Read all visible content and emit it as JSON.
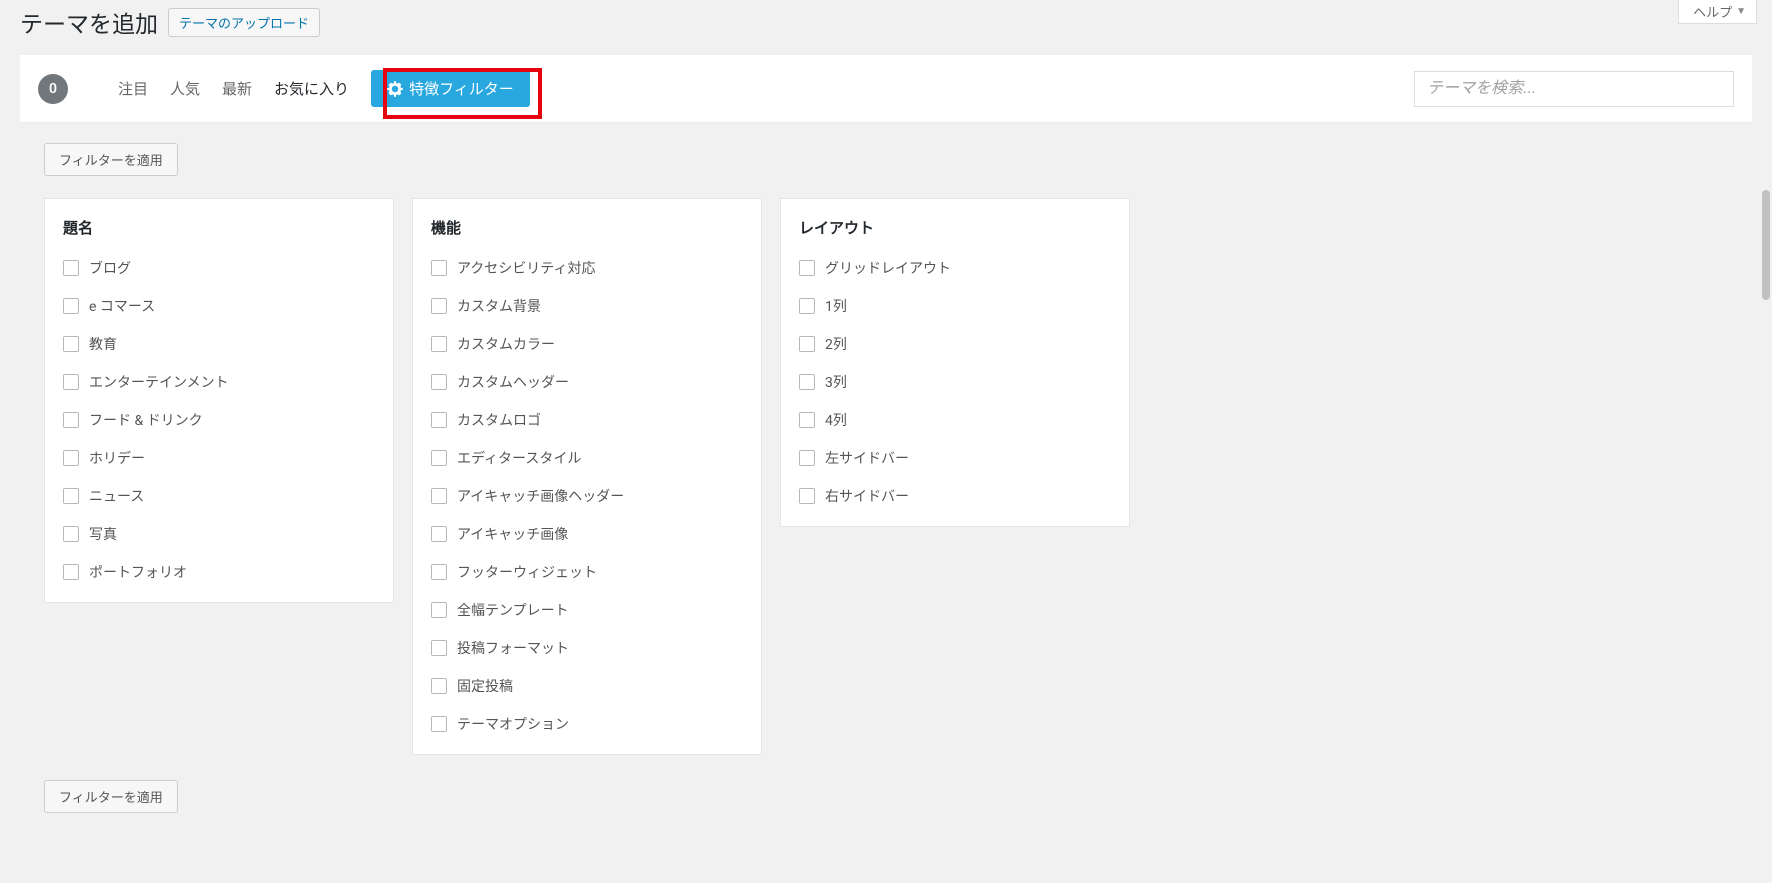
{
  "header": {
    "title": "テーマを追加",
    "upload_button": "テーマのアップロード",
    "help_label": "ヘルプ"
  },
  "toolbar": {
    "count": "0",
    "tabs": {
      "featured": "注目",
      "popular": "人気",
      "latest": "最新",
      "favorites": "お気に入り"
    },
    "feature_filter": "特徴フィルター",
    "search_placeholder": "テーマを検索..."
  },
  "apply_filter": "フィルターを適用",
  "filters": {
    "subject": {
      "heading": "題名",
      "items": [
        "ブログ",
        "e コマース",
        "教育",
        "エンターテインメント",
        "フード & ドリンク",
        "ホリデー",
        "ニュース",
        "写真",
        "ポートフォリオ"
      ]
    },
    "features": {
      "heading": "機能",
      "items": [
        "アクセシビリティ対応",
        "カスタム背景",
        "カスタムカラー",
        "カスタムヘッダー",
        "カスタムロゴ",
        "エディタースタイル",
        "アイキャッチ画像ヘッダー",
        "アイキャッチ画像",
        "フッターウィジェット",
        "全幅テンプレート",
        "投稿フォーマット",
        "固定投稿",
        "テーマオプション"
      ]
    },
    "layout": {
      "heading": "レイアウト",
      "items": [
        "グリッドレイアウト",
        "1列",
        "2列",
        "3列",
        "4列",
        "左サイドバー",
        "右サイドバー"
      ]
    }
  }
}
